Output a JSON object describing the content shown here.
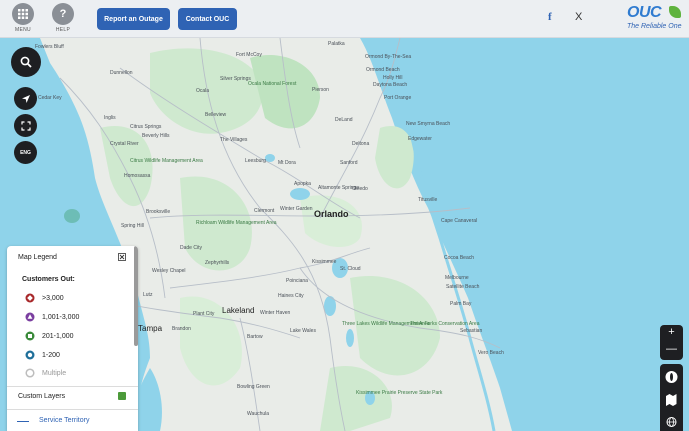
{
  "header": {
    "menu_label": "MENU",
    "help_label": "HELP",
    "help_glyph": "?",
    "report_outage": "Report an Outage",
    "contact": "Contact OUC",
    "facebook_glyph": "f",
    "x_glyph": "X",
    "logo": "OUC",
    "tagline": "The Reliable One"
  },
  "map_controls": {
    "language": "ENG"
  },
  "places": [
    {
      "name": "Fowlers Bluff",
      "cls": ""
    },
    {
      "name": "Dunnellon",
      "cls": ""
    },
    {
      "name": "Cedar Key",
      "cls": ""
    },
    {
      "name": "Inglis",
      "cls": ""
    },
    {
      "name": "Citrus Springs",
      "cls": ""
    },
    {
      "name": "Beverly Hills",
      "cls": ""
    },
    {
      "name": "Crystal River",
      "cls": ""
    },
    {
      "name": "Homosassa",
      "cls": ""
    },
    {
      "name": "Brooksville",
      "cls": ""
    },
    {
      "name": "Spring Hill",
      "cls": ""
    },
    {
      "name": "Dade City",
      "cls": ""
    },
    {
      "name": "Wesley Chapel",
      "cls": ""
    },
    {
      "name": "Zephyrhills",
      "cls": ""
    },
    {
      "name": "Lutz",
      "cls": ""
    },
    {
      "name": "Tampa",
      "cls": "mid"
    },
    {
      "name": "Plant City",
      "cls": ""
    },
    {
      "name": "Brandon",
      "cls": ""
    },
    {
      "name": "Lakeland",
      "cls": "mid"
    },
    {
      "name": "Ocala",
      "cls": ""
    },
    {
      "name": "Belleview",
      "cls": ""
    },
    {
      "name": "The Villages",
      "cls": ""
    },
    {
      "name": "Leesburg",
      "cls": ""
    },
    {
      "name": "Mt Dora",
      "cls": ""
    },
    {
      "name": "Clermont",
      "cls": ""
    },
    {
      "name": "Winter Garden",
      "cls": ""
    },
    {
      "name": "Apopka",
      "cls": ""
    },
    {
      "name": "Altamonte Springs",
      "cls": ""
    },
    {
      "name": "Orlando",
      "cls": "big"
    },
    {
      "name": "Oviedo",
      "cls": ""
    },
    {
      "name": "Sanford",
      "cls": ""
    },
    {
      "name": "Kissimmee",
      "cls": ""
    },
    {
      "name": "St. Cloud",
      "cls": ""
    },
    {
      "name": "Poinciana",
      "cls": ""
    },
    {
      "name": "Haines City",
      "cls": ""
    },
    {
      "name": "Winter Haven",
      "cls": ""
    },
    {
      "name": "Lake Wales",
      "cls": ""
    },
    {
      "name": "Bartow",
      "cls": ""
    },
    {
      "name": "Bowling Green",
      "cls": ""
    },
    {
      "name": "Wauchula",
      "cls": ""
    },
    {
      "name": "Palatka",
      "cls": ""
    },
    {
      "name": "Ormond By-The-Sea",
      "cls": ""
    },
    {
      "name": "Ormond Beach",
      "cls": ""
    },
    {
      "name": "Holly Hill",
      "cls": ""
    },
    {
      "name": "Daytona Beach",
      "cls": ""
    },
    {
      "name": "Port Orange",
      "cls": ""
    },
    {
      "name": "DeLand",
      "cls": ""
    },
    {
      "name": "Deltona",
      "cls": ""
    },
    {
      "name": "New Smyrna Beach",
      "cls": ""
    },
    {
      "name": "Edgewater",
      "cls": ""
    },
    {
      "name": "Titusville",
      "cls": ""
    },
    {
      "name": "Cape Canaveral",
      "cls": ""
    },
    {
      "name": "Cocoa Beach",
      "cls": ""
    },
    {
      "name": "Melbourne",
      "cls": ""
    },
    {
      "name": "Satellite Beach",
      "cls": ""
    },
    {
      "name": "Palm Bay",
      "cls": ""
    },
    {
      "name": "Sebastian",
      "cls": ""
    },
    {
      "name": "Vero Beach",
      "cls": ""
    },
    {
      "name": "Fort McCoy",
      "cls": ""
    },
    {
      "name": "Silver Springs",
      "cls": ""
    },
    {
      "name": "Pierson",
      "cls": ""
    },
    {
      "name": "Ocala National Forest",
      "cls": "park"
    },
    {
      "name": "Citrus Wildlife Management Area",
      "cls": "park"
    },
    {
      "name": "Richloam Wildlife Management Area",
      "cls": "park"
    },
    {
      "name": "Three Lakes Wildlife Management Area",
      "cls": "park"
    },
    {
      "name": "Three Forks Conservation Area",
      "cls": "park"
    },
    {
      "name": "Kissimmee Prairie Preserve State Park",
      "cls": "park"
    }
  ],
  "legend": {
    "title": "Map Legend",
    "subtitle": "Customers Out:",
    "items": [
      {
        "label": ">3,000",
        "color": "#c0392b",
        "shape": "diamond"
      },
      {
        "label": "1,001-3,000",
        "color": "#7b3fa0",
        "shape": "triangle"
      },
      {
        "label": "201-1,000",
        "color": "#3a8a3a",
        "shape": "square"
      },
      {
        "label": "1-200",
        "color": "#1f6f9a",
        "shape": "circle"
      },
      {
        "label": "Multiple",
        "color": "#b8b8b8",
        "shape": "ring"
      }
    ],
    "custom_layers": "Custom Layers",
    "service_territory": "Service Territory"
  },
  "zoom": {
    "plus": "+",
    "minus": "—"
  }
}
